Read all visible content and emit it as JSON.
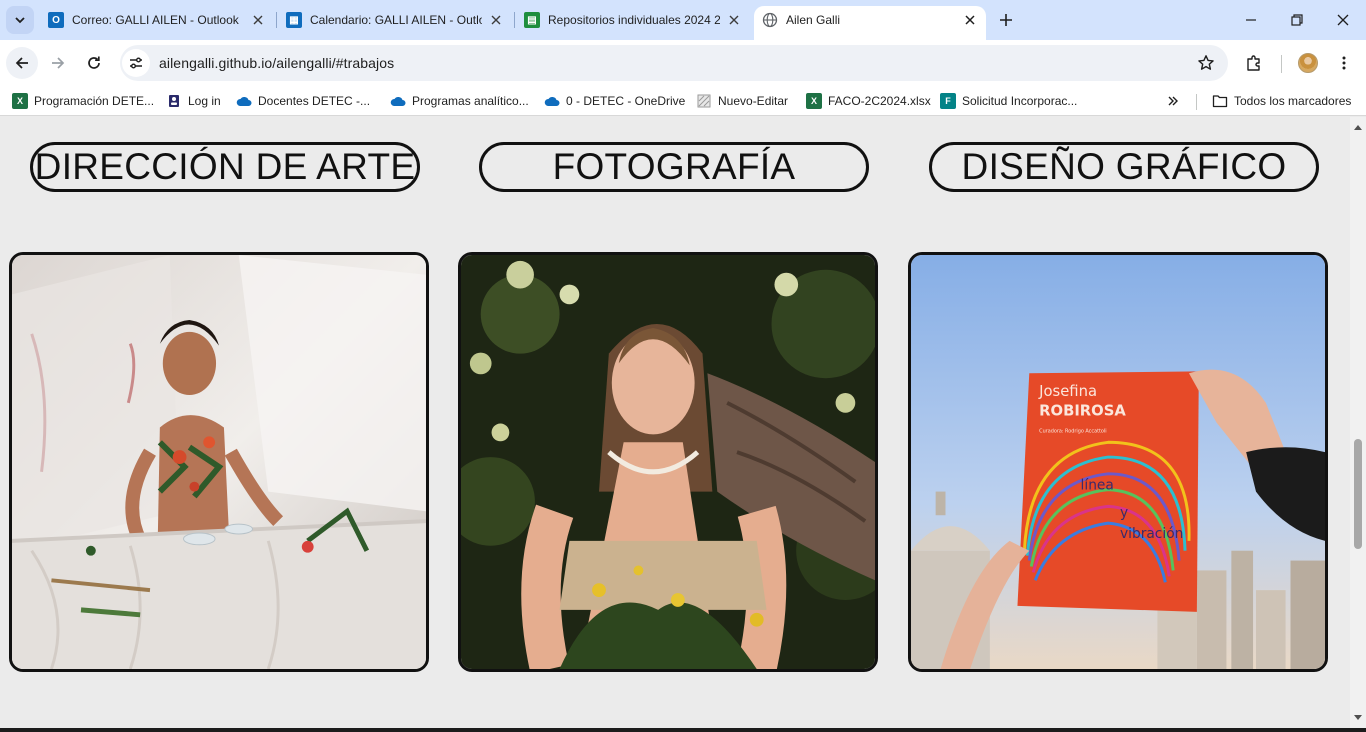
{
  "tabs": [
    {
      "title": "Correo: GALLI AILEN - Outlook",
      "icon": "outlook-icon",
      "color": "#0f6cbd"
    },
    {
      "title": "Calendario: GALLI AILEN - Outlo",
      "icon": "calendar-icon",
      "color": "#0f6cbd"
    },
    {
      "title": "Repositorios individuales 2024 2",
      "icon": "sheets-icon",
      "color": "#1e8e3e"
    },
    {
      "title": "Ailen Galli",
      "icon": "globe-icon",
      "color": "#5f6368"
    }
  ],
  "toolbar": {
    "url": "ailengalli.github.io/ailengalli/#trabajos"
  },
  "bookmarks": {
    "items": [
      {
        "label": "Programación DETE...",
        "icon": "excel-icon"
      },
      {
        "label": "Log in",
        "icon": "login-icon"
      },
      {
        "label": "Docentes DETEC -...",
        "icon": "onedrive-icon"
      },
      {
        "label": "Programas analítico...",
        "icon": "onedrive-icon"
      },
      {
        "label": "0 - DETEC - OneDrive",
        "icon": "onedrive-icon"
      },
      {
        "label": "Nuevo-Editar",
        "icon": "edit-icon"
      },
      {
        "label": "FACO-2C2024.xlsx",
        "icon": "excel-icon"
      },
      {
        "label": "Solicitud Incorporac...",
        "icon": "forms-icon"
      }
    ],
    "all_label": "Todos los marcadores"
  },
  "page": {
    "categories": [
      "DIRECCIÓN DE ARTE",
      "FOTOGRAFÍA",
      "DISEÑO GRÁFICO"
    ],
    "book": {
      "author_first": "Josefina",
      "author_last": "ROBIROSA",
      "subtitle": "Curadora: Rodrigo Accattoli",
      "title_1": "línea",
      "title_2": "y",
      "title_3": "vibración"
    }
  },
  "colors": {
    "tabstrip": "#d3e3fd",
    "page_bg": "#ebebeb",
    "border": "#111111"
  }
}
